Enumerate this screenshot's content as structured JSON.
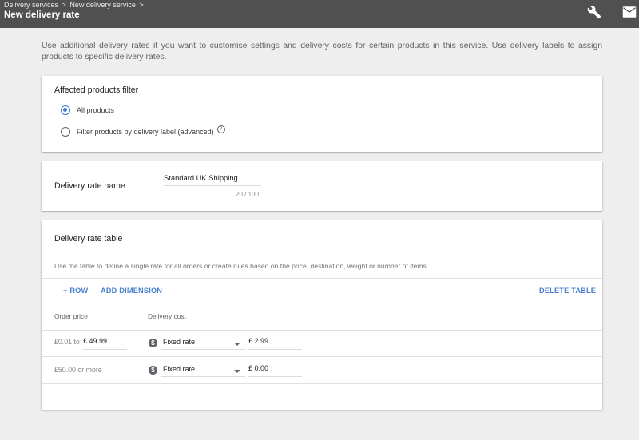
{
  "header": {
    "breadcrumbs": [
      "Delivery services",
      ">",
      "New delivery service",
      ">"
    ],
    "title": "New delivery rate",
    "icons": [
      "wrench-icon",
      "mail-icon"
    ]
  },
  "intro": "Use additional delivery rates if you want to customise settings and delivery costs for certain products in this service. Use delivery labels to assign products to specific delivery rates.",
  "filter": {
    "title": "Affected products filter",
    "options": [
      {
        "label": "All products",
        "selected": true
      },
      {
        "label": "Filter products by delivery label (advanced)",
        "selected": false
      }
    ],
    "help_glyph": "?"
  },
  "rate_name": {
    "label": "Delivery rate name",
    "value": "Standard UK Shipping",
    "counter": "20 / 100"
  },
  "rate_table": {
    "title": "Delivery rate table",
    "description": "Use the table to define a single rate for all orders or create rules based on the price, destination, weight or number of items.",
    "actions": {
      "add_row": "+ ROW",
      "add_dimension": "ADD DIMENSION",
      "delete_table": "DELETE TABLE"
    },
    "columns": [
      "Order price",
      "Delivery cost"
    ],
    "rows": [
      {
        "price_from": "£0.01 to",
        "price_to": "£ 49.99",
        "rate_type": "Fixed rate",
        "cost": "£ 2.99"
      },
      {
        "price_from": "£50.00 or more",
        "price_to": "",
        "rate_type": "Fixed rate",
        "cost": "£ 0.00"
      }
    ],
    "currency_glyph": "$"
  }
}
